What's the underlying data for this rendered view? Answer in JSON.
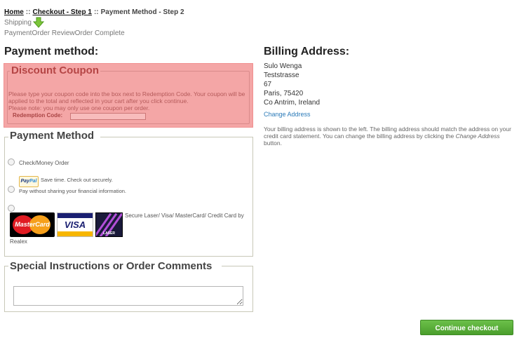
{
  "breadcrumb": {
    "home": "Home",
    "separator": "::",
    "step1": "Checkout - Step 1",
    "current": "Payment Method - Step 2"
  },
  "progress": {
    "shipping": "Shipping",
    "payment": "Payment",
    "review": "Order Review",
    "complete": "Order Complete"
  },
  "payment_section": {
    "title": "Payment method:"
  },
  "coupon": {
    "legend": "Discount Coupon",
    "instructions_1": "Please type your coupon code into the box next to Redemption Code. Your coupon will be applied to the total and reflected in your cart after you click continue.",
    "instructions_2": "Please note: you may only use one coupon per order.",
    "redemption_label": "Redemption Code:",
    "redemption_value": ""
  },
  "payment_method": {
    "legend": "Payment Method",
    "check_label": "Check/Money Order",
    "paypal_tagline": "Save time. Check out securely.",
    "paypal_sub": "Pay without sharing your financial information.",
    "paypal_logo_1": "Pay",
    "paypal_logo_2": "Pal",
    "card_label_1": "Secure Laser/ Visa/ MasterCard/ Credit Card by",
    "card_label_2": "Realex",
    "mastercard_text": "MasterCard",
    "visa_text": "VISA",
    "laser_text": "LASER"
  },
  "comments": {
    "legend": "Special Instructions or Order Comments",
    "value": ""
  },
  "billing": {
    "title": "Billing Address:",
    "name": "Sulo Wenga",
    "street": "Teststrasse",
    "number": "67",
    "city": "Paris, 75420",
    "region": "Co Antrim, Ireland",
    "change_link": "Change Address",
    "note_1": "Your billing address is shown to the left. The billing address should match the address on your credit card statement. You can change the billing address by clicking the",
    "note_link": "Change Address",
    "note_2": "button."
  },
  "actions": {
    "continue": "Continue checkout"
  },
  "colors": {
    "coupon_bg": "#f4a6a6",
    "accent_green": "#5aaf3a",
    "link_blue": "#2a7ab8"
  }
}
